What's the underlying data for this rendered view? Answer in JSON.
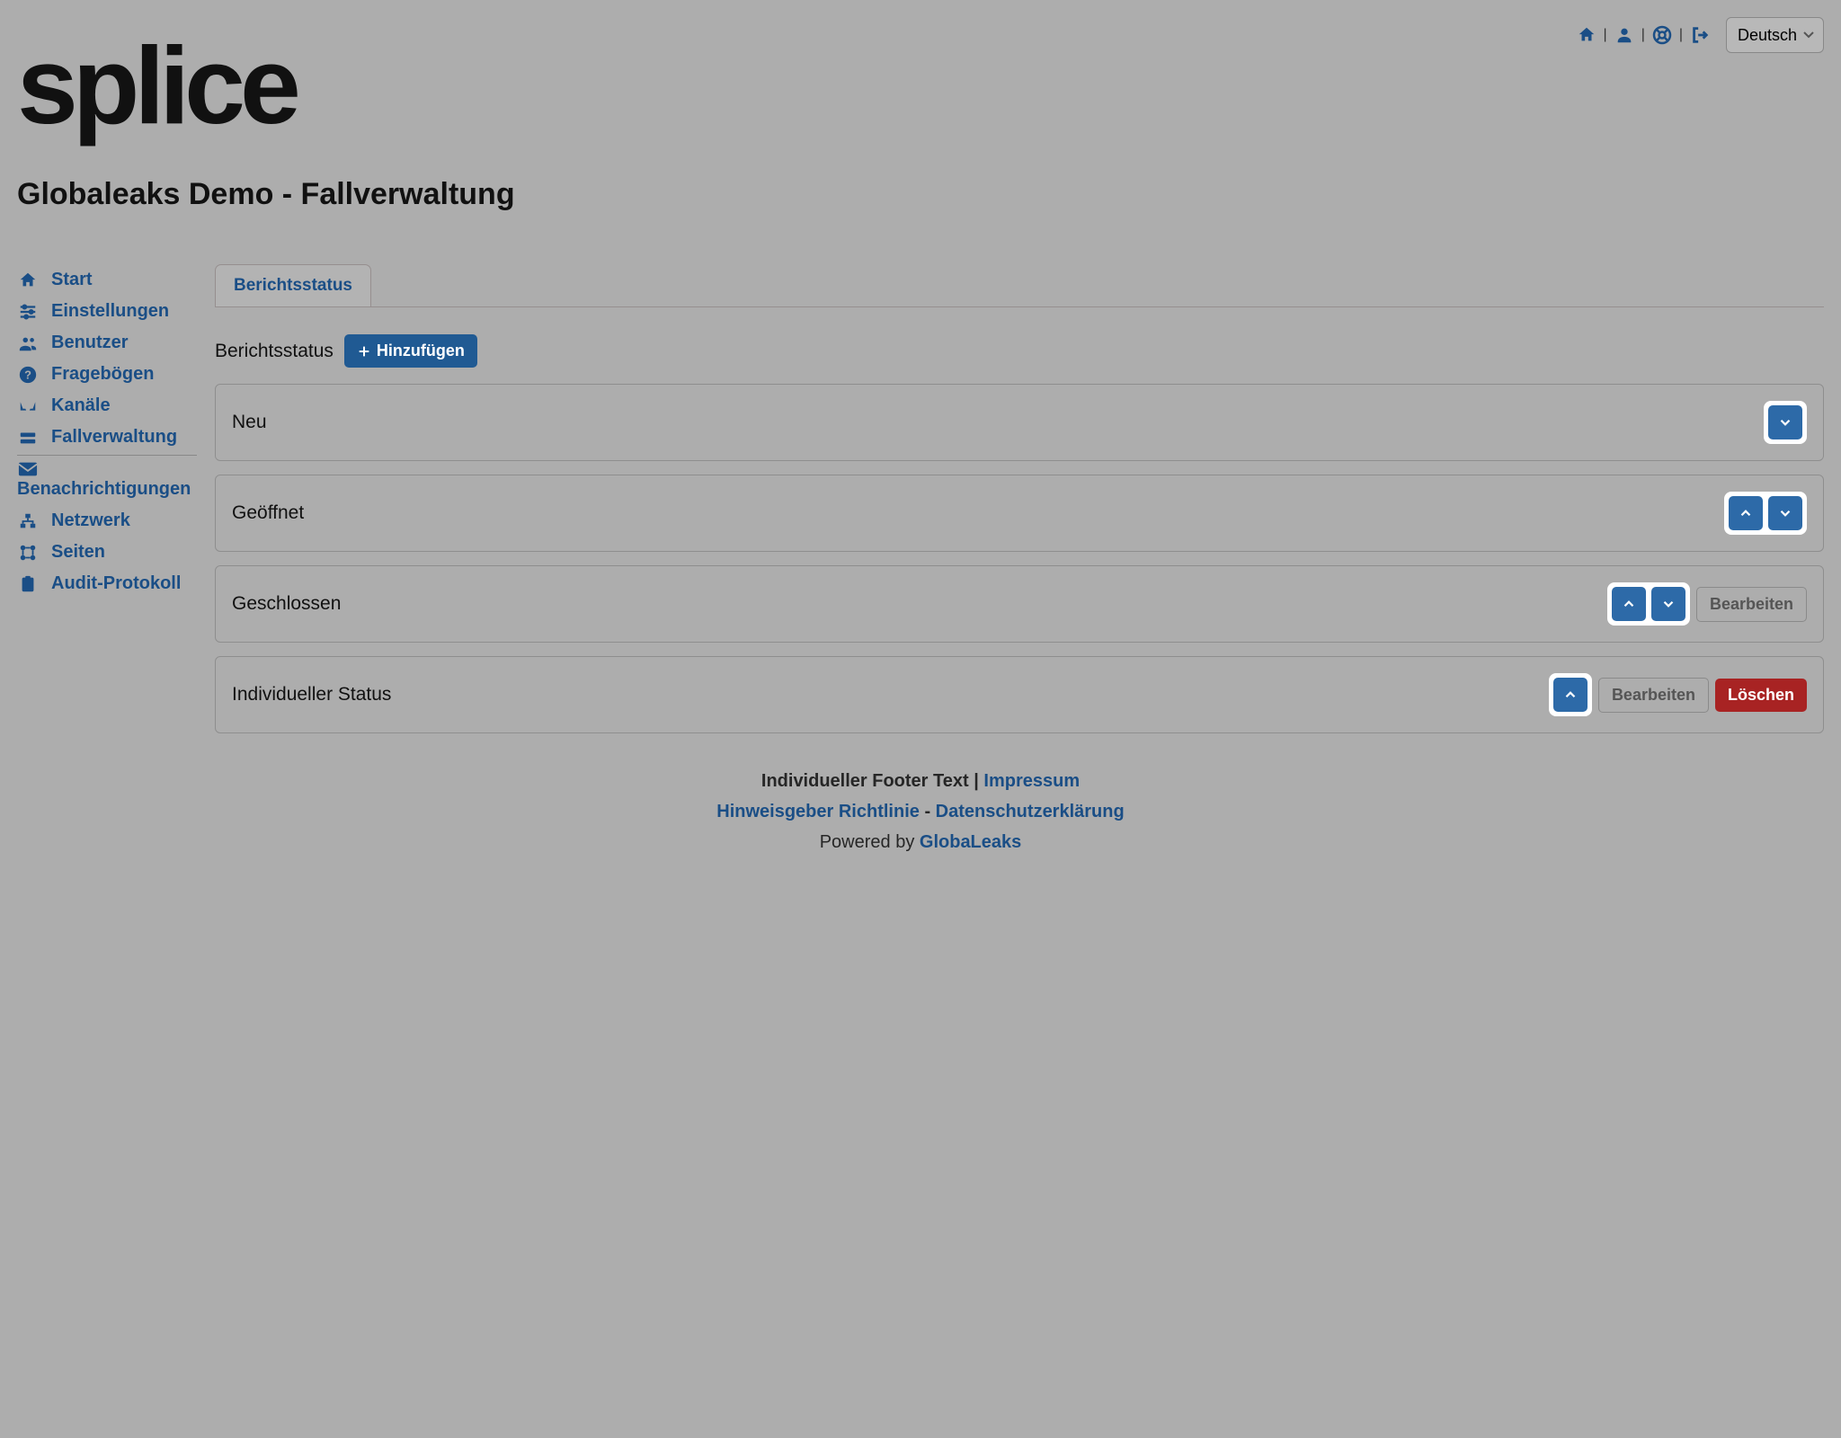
{
  "brand": {
    "logo_text": "splice"
  },
  "header": {
    "language_selected": "Deutsch"
  },
  "page": {
    "title": "Globaleaks Demo - Fallverwaltung"
  },
  "sidebar": {
    "items": {
      "home": "Start",
      "settings": "Einstellungen",
      "users": "Benutzer",
      "questionnaires": "Fragebögen",
      "channels": "Kanäle",
      "case": "Fallverwaltung",
      "notifications": "Benachrichtigungen",
      "network": "Netzwerk",
      "pages": "Seiten",
      "audit": "Audit-Protokoll"
    }
  },
  "tab": {
    "report_status": "Berichtsstatus"
  },
  "section": {
    "title": "Berichtsstatus",
    "add_label": "Hinzufügen",
    "edit_label": "Bearbeiten",
    "delete_label": "Löschen"
  },
  "statuses": [
    {
      "label": "Neu"
    },
    {
      "label": "Geöffnet"
    },
    {
      "label": "Geschlossen"
    },
    {
      "label": "Individueller Status"
    }
  ],
  "footer": {
    "custom": "Individueller Footer Text",
    "imprint": "Impressum",
    "whistle": "Hinweisgeber Richtlinie",
    "privacy": "Datenschutzerklärung",
    "powered": "Powered by",
    "gl": "GlobaLeaks"
  }
}
